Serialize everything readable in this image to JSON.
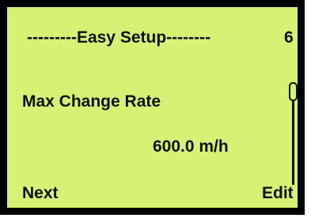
{
  "header": {
    "title": "---------Easy Setup--------",
    "page_number": "6"
  },
  "parameter": {
    "label": "Max Change Rate",
    "value": "600.0 m/h"
  },
  "scrollbar": {
    "position_fraction": 0.0
  },
  "softkeys": {
    "left_label": "Next",
    "right_label": "Edit"
  },
  "colors": {
    "lcd_background": "#d6f176",
    "lcd_text": "#111111",
    "bezel": "#000000"
  }
}
